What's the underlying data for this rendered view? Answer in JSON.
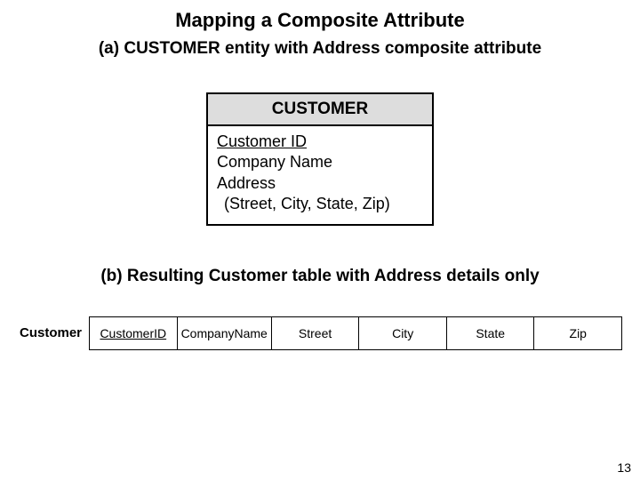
{
  "title": "Mapping a Composite Attribute",
  "section_a": {
    "label": "(a) CUSTOMER entity with Address composite attribute",
    "entity_name": "CUSTOMER",
    "attributes": {
      "pk": "Customer ID",
      "a1": "Company Name",
      "a2": "Address",
      "composite_sub": "(Street, City, State, Zip)"
    }
  },
  "section_b": {
    "label": "(b) Resulting Customer table with Address details only",
    "table_name": "Customer",
    "columns": {
      "c0": "CustomerID",
      "c1": "CompanyName",
      "c2": "Street",
      "c3": "City",
      "c4": "State",
      "c5": "Zip"
    }
  },
  "page_number": "13"
}
